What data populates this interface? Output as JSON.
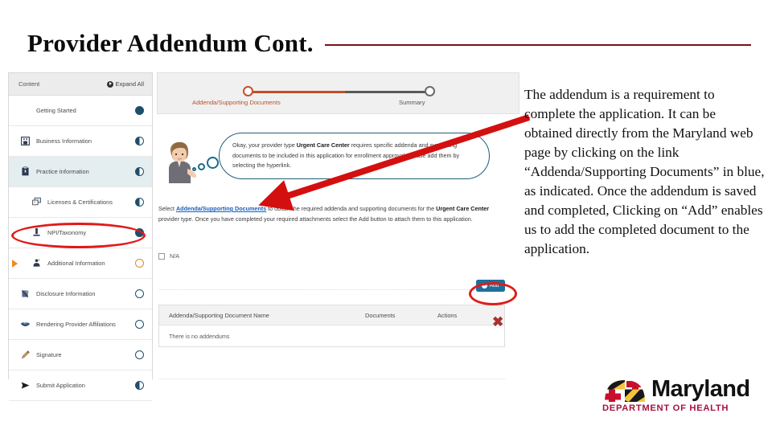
{
  "slide": {
    "title": "Provider Addendum Cont.",
    "rule_color": "#7d1014"
  },
  "body_text": "The addendum is a requirement to complete the application. It can be obtained directly from the Maryland web page by clicking on the link “Addenda/Supporting Documents” in blue, as indicated. Once the addendum is saved and completed, Clicking on “Add” enables us to add the completed document to the application.",
  "sidebar": {
    "header": {
      "title": "Content",
      "expand_all": "Expand All"
    },
    "items": [
      {
        "label": "Getting Started",
        "status": "full",
        "icon": "none",
        "sub": false,
        "active": false,
        "highlight": false
      },
      {
        "label": "Business Information",
        "status": "half",
        "icon": "building-icon",
        "sub": false,
        "active": false,
        "highlight": false
      },
      {
        "label": "Practice Information",
        "status": "half",
        "icon": "clipboard-icon",
        "sub": false,
        "active": true,
        "highlight": false
      },
      {
        "label": "Licenses & Certifications",
        "status": "half",
        "icon": "license-icon",
        "sub": true,
        "active": false,
        "highlight": false
      },
      {
        "label": "NPI/Taxonomy",
        "status": "full",
        "icon": "npi-icon",
        "sub": true,
        "active": false,
        "highlight": false
      },
      {
        "label": "Additional Information",
        "status": "orange",
        "icon": "person-icon",
        "sub": true,
        "active": false,
        "highlight": true
      },
      {
        "label": "Disclosure Information",
        "status": "empty",
        "icon": "disclose-icon",
        "sub": false,
        "active": false,
        "highlight": false
      },
      {
        "label": "Rendering Provider Affiliations",
        "status": "empty",
        "icon": "handshake-icon",
        "sub": false,
        "active": false,
        "highlight": false
      },
      {
        "label": "Signature",
        "status": "empty",
        "icon": "pen-icon",
        "sub": false,
        "active": false,
        "highlight": false
      },
      {
        "label": "Submit Application",
        "status": "half",
        "icon": "send-icon",
        "sub": false,
        "active": false,
        "highlight": false
      }
    ]
  },
  "main": {
    "stepper": {
      "step_one": "Addenda/Supporting Documents",
      "step_two": "Summary",
      "active_color": "#c0512a",
      "inactive_color": "#5a5a5a"
    },
    "bubble": {
      "text_before": "Okay, your provider type ",
      "provider_type": "Urgent Care Center",
      "text_after": " requires specific addenda and supporting documents to be included in this application for enrollment approval. Please add them by selecting the hyperlink."
    },
    "instruction": {
      "lead": "Select ",
      "link": "Addenda/Supporting Documents",
      "mid": " to obtain the required addenda and supporting documents for the ",
      "provider_type": "Urgent Care Center",
      "tail": " provider type. Once you have completed your required attachments select the Add button to attach them to this application.",
      "link_color": "#1b5fb8"
    },
    "na_checkbox_label": "N/A",
    "add_button": {
      "label": "Add",
      "plus": "+",
      "color": "#1f6f9a"
    },
    "table": {
      "headers": [
        "Addenda/Supporting Document Name",
        "Documents",
        "Actions"
      ],
      "empty_message": "There is no addendums"
    }
  },
  "annotations": {
    "arrow_color": "#d40f0f",
    "ellipse_color": "#e01b19",
    "x_mark": "✖"
  },
  "logo": {
    "wordmark": "Maryland",
    "subtitle": "DEPARTMENT OF HEALTH",
    "subtitle_color": "#a4123f"
  }
}
